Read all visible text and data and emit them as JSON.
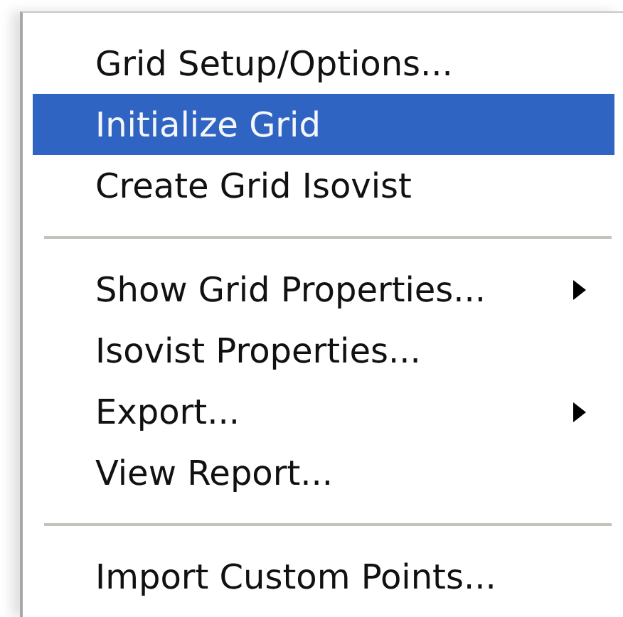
{
  "menu": {
    "items": [
      {
        "kind": "item",
        "label": "Grid Setup/Options...",
        "selected": false,
        "submenu": false
      },
      {
        "kind": "item",
        "label": "Initialize Grid",
        "selected": true,
        "submenu": false
      },
      {
        "kind": "item",
        "label": "Create Grid Isovist",
        "selected": false,
        "submenu": false
      },
      {
        "kind": "separator"
      },
      {
        "kind": "item",
        "label": "Show Grid Properties...",
        "selected": false,
        "submenu": true
      },
      {
        "kind": "item",
        "label": "Isovist Properties...",
        "selected": false,
        "submenu": false
      },
      {
        "kind": "item",
        "label": "Export...",
        "selected": false,
        "submenu": true
      },
      {
        "kind": "item",
        "label": "View Report...",
        "selected": false,
        "submenu": false
      },
      {
        "kind": "separator"
      },
      {
        "kind": "item",
        "label": "Import Custom Points...",
        "selected": false,
        "submenu": false
      }
    ]
  }
}
